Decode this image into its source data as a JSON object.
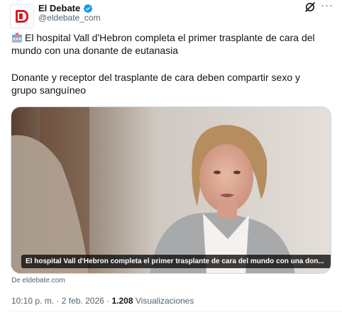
{
  "account": {
    "display_name": "El Debate",
    "handle": "@eldebate_com",
    "verified": true,
    "brand_color": "#d21f25"
  },
  "tweet": {
    "emoji_icon": "hospital-icon",
    "headline": "El hospital Vall d'Hebron completa el primer trasplante de cara del mundo con una donante de eutanasia",
    "subtitle": "Donante y receptor del trasplante de cara deben compartir sexo y grupo sanguíneo"
  },
  "media": {
    "caption": "El hospital Vall d'Hebron completa el primer trasplante de cara del mundo con una don...",
    "source": "De eldebate.com"
  },
  "meta": {
    "time": "10:10 p. m.",
    "separator": "·",
    "date": "2 feb. 2026",
    "views_count": "1.208",
    "views_label": "Visualizaciones"
  },
  "colors": {
    "text": "#0f1419",
    "secondary": "#536471",
    "verified": "#1d9bf0"
  }
}
